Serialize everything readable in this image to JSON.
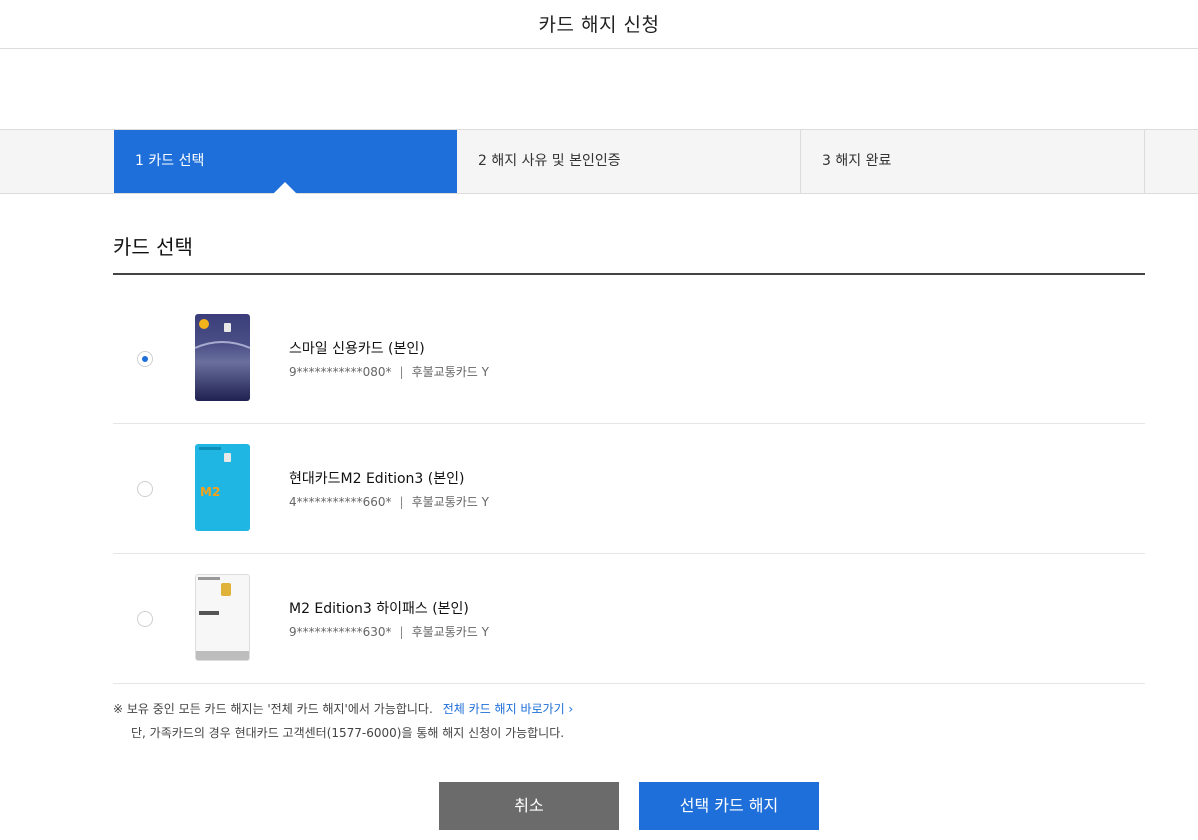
{
  "header": {
    "title": "카드 해지 신청"
  },
  "steps": [
    {
      "label": "1 카드 선택",
      "active": true
    },
    {
      "label": "2 해지 사유 및 본인인증",
      "active": false
    },
    {
      "label": "3 해지 완료",
      "active": false
    }
  ],
  "section": {
    "title": "카드 선택"
  },
  "cards": [
    {
      "name": "스마일 신용카드 (본인)",
      "number": "9***********080*",
      "transit": "후불교통카드 Y",
      "selected": true,
      "brand_color": "#2d2f5e"
    },
    {
      "name": "현대카드M2 Edition3 (본인)",
      "number": "4***********660*",
      "transit": "후불교통카드 Y",
      "selected": false,
      "brand_color": "#1fb6e3"
    },
    {
      "name": "M2 Edition3 하이패스 (본인)",
      "number": "9***********630*",
      "transit": "후불교통카드 Y",
      "selected": false,
      "brand_color": "#f5f5f5"
    }
  ],
  "notes": {
    "line1": "※ 보유 중인 모든 카드 해지는 '전체 카드 해지'에서 가능합니다.",
    "link": "전체 카드 해지 바로가기 ›",
    "line2": "단, 가족카드의 경우 현대카드 고객센터(1577-6000)을 통해 해지 신청이 가능합니다."
  },
  "buttons": {
    "cancel": "취소",
    "submit": "선택 카드 해지"
  },
  "colors": {
    "accent": "#1e6fd9",
    "cancel_bg": "#6b6b6b"
  }
}
